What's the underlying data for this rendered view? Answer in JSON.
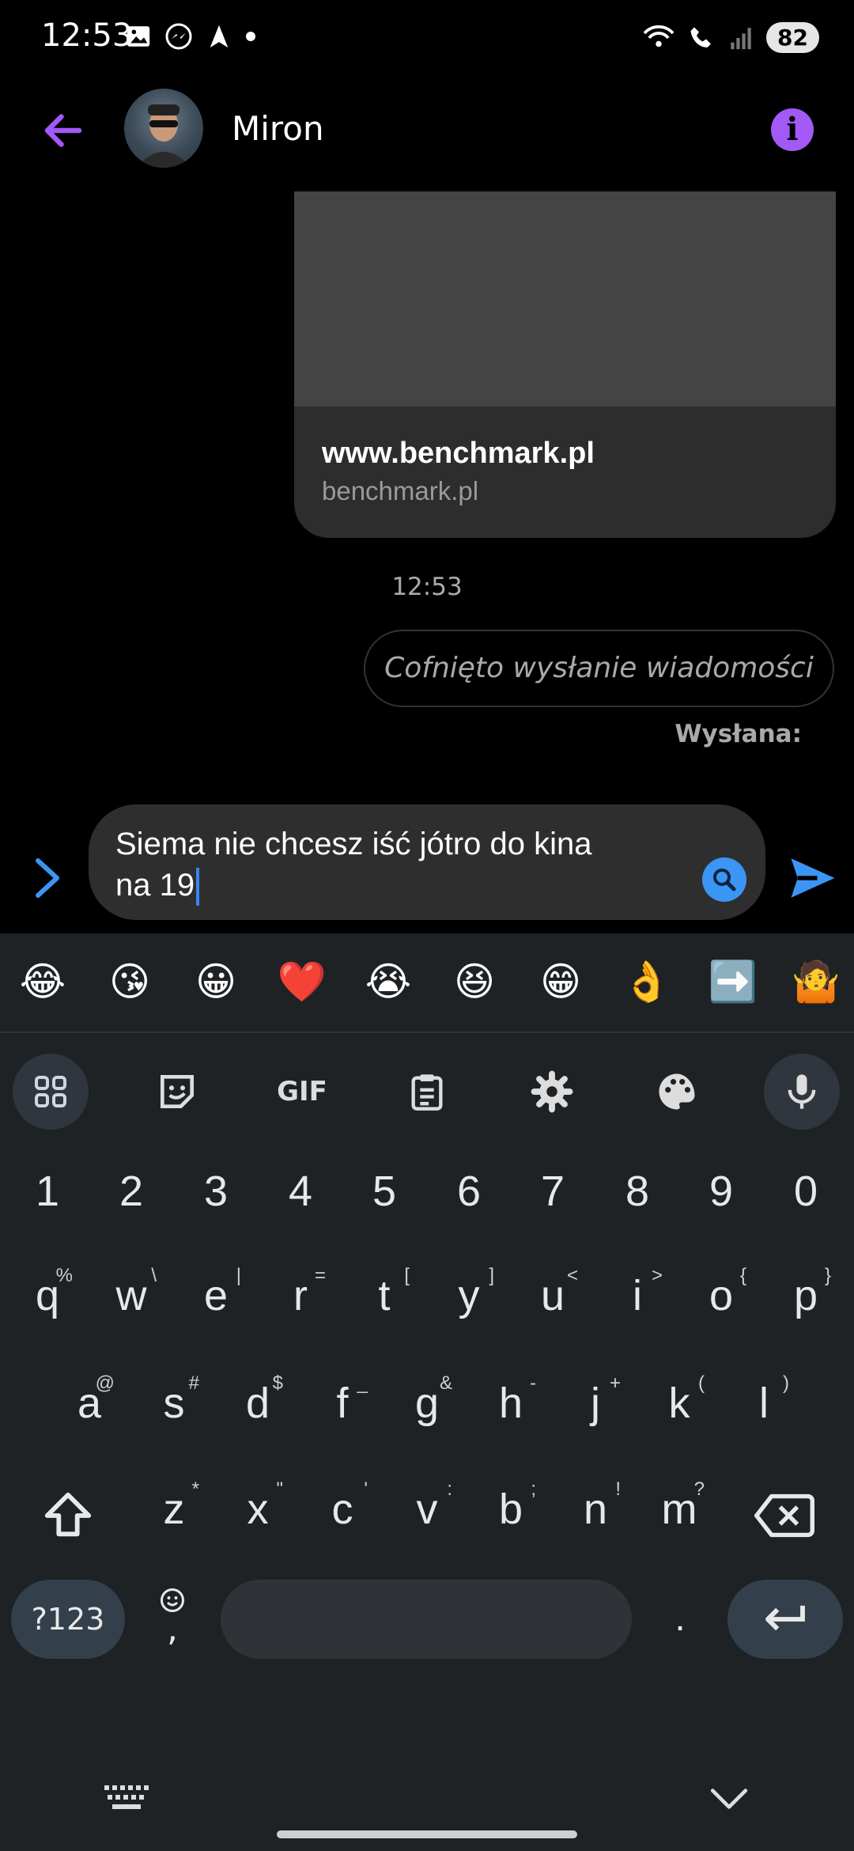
{
  "status_bar": {
    "time": "12:53",
    "battery": "82"
  },
  "header": {
    "contact_name": "Miron"
  },
  "link_preview": {
    "title": "www.benchmark.pl",
    "domain": "benchmark.pl"
  },
  "conversation": {
    "timestamp": "12:53",
    "unsent_notice": "Cofnięto wysłanie wiadomości",
    "sent_status": "Wysłana:"
  },
  "composer": {
    "text_line1": "Siema nie chcesz iść jótro do kina",
    "text_line2": "na 19"
  },
  "keyboard": {
    "emoji_suggestions": [
      "😂",
      "😘",
      "😀",
      "❤️",
      "😭",
      "😆",
      "😁",
      "👌",
      "➡️",
      "🤷"
    ],
    "toolbar_gif": "GIF",
    "number_row": [
      "1",
      "2",
      "3",
      "4",
      "5",
      "6",
      "7",
      "8",
      "9",
      "0"
    ],
    "row1": [
      "q",
      "w",
      "e",
      "r",
      "t",
      "y",
      "u",
      "i",
      "o",
      "p"
    ],
    "row1_hints": [
      "%",
      "\\",
      "|",
      "=",
      "[",
      "]",
      "<",
      ">",
      "{",
      "}"
    ],
    "row2": [
      "a",
      "s",
      "d",
      "f",
      "g",
      "h",
      "j",
      "k",
      "l"
    ],
    "row2_hints": [
      "@",
      "#",
      "$",
      "_",
      "&",
      "-",
      "+",
      "(",
      ")"
    ],
    "row3": [
      "z",
      "x",
      "c",
      "v",
      "b",
      "n",
      "m"
    ],
    "row3_hints": [
      "*",
      "\"",
      "'",
      ":",
      ";",
      "!",
      "?"
    ],
    "symbols_label": "?123",
    "comma_label": ",",
    "period_label": "."
  }
}
